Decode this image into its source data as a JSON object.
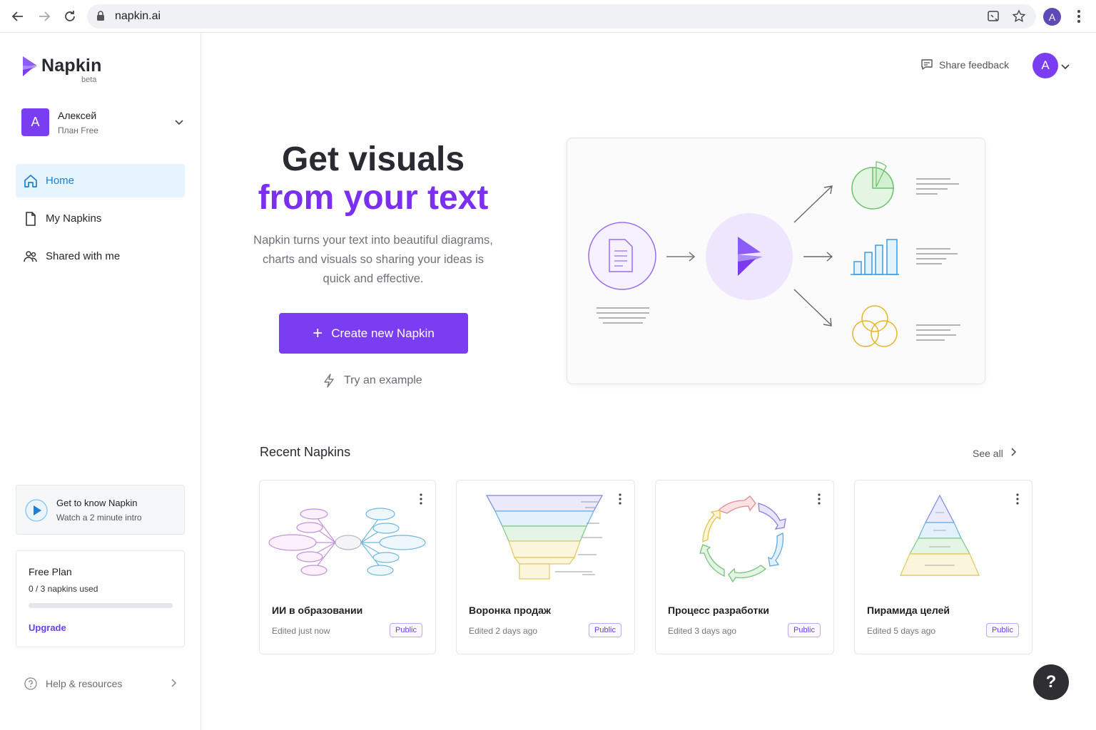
{
  "browser": {
    "url": "napkin.ai",
    "profile_initial": "A"
  },
  "sidebar": {
    "logo_text": "Napkin",
    "logo_badge": "beta",
    "user": {
      "initial": "A",
      "name": "Алексей",
      "plan": "План Free"
    },
    "nav": [
      {
        "label": "Home",
        "icon": "home-icon",
        "active": true
      },
      {
        "label": "My Napkins",
        "icon": "document-icon",
        "active": false
      },
      {
        "label": "Shared with me",
        "icon": "users-icon",
        "active": false
      }
    ],
    "intro": {
      "title": "Get to know Napkin",
      "subtitle": "Watch a 2 minute intro"
    },
    "plan_card": {
      "title": "Free Plan",
      "usage": "0 / 3 napkins used",
      "progress": 0,
      "upgrade_label": "Upgrade"
    },
    "help_label": "Help & resources"
  },
  "header": {
    "feedback_label": "Share feedback",
    "avatar_initial": "A"
  },
  "hero": {
    "title_line1": "Get visuals",
    "title_line2": "from your text",
    "description": "Napkin turns your text into beautiful diagrams, charts and visuals so sharing your ideas is quick and effective.",
    "cta_label": "Create new Napkin",
    "try_label": "Try an example"
  },
  "recent": {
    "title": "Recent Napkins",
    "see_all_label": "See all",
    "cards": [
      {
        "title": "ИИ в образовании",
        "edited": "Edited just now",
        "badge": "Public",
        "thumb": "mindmap"
      },
      {
        "title": "Воронка продаж",
        "edited": "Edited 2 days ago",
        "badge": "Public",
        "thumb": "funnel"
      },
      {
        "title": "Процесс разработки",
        "edited": "Edited 3 days ago",
        "badge": "Public",
        "thumb": "cycle"
      },
      {
        "title": "Пирамида целей",
        "edited": "Edited 5 days ago",
        "badge": "Public",
        "thumb": "pyramid"
      }
    ]
  },
  "help_fab_label": "?",
  "colors": {
    "accent": "#7b3df2",
    "accent_text": "#7b2ff0",
    "nav_active_bg": "#e6f4fd",
    "nav_active_text": "#1c7ed6"
  }
}
